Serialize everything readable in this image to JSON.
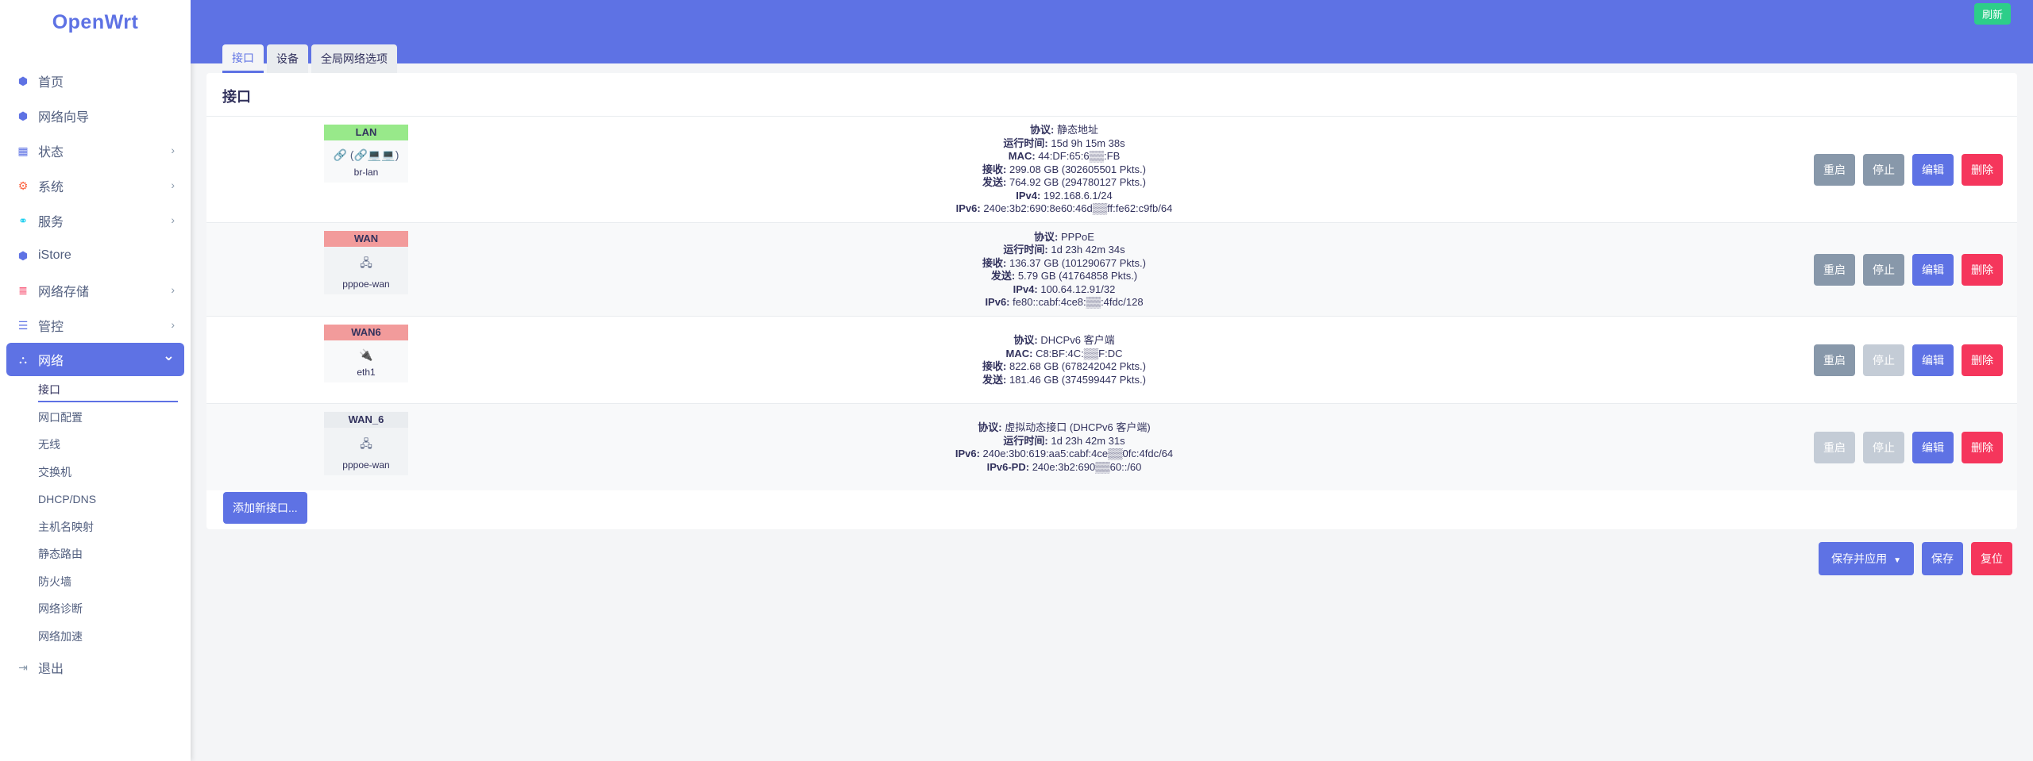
{
  "app": {
    "logo": "OpenWrt",
    "refresh_label": "刷新"
  },
  "sidebar": {
    "items": [
      {
        "label": "首页",
        "icon": "cube-icon",
        "chevron": false
      },
      {
        "label": "网络向导",
        "icon": "cube-icon",
        "chevron": false
      },
      {
        "label": "状态",
        "icon": "grid-icon",
        "chevron": true
      },
      {
        "label": "系统",
        "icon": "gear-icon",
        "chevron": true
      },
      {
        "label": "服务",
        "icon": "link-icon",
        "chevron": true
      },
      {
        "label": "iStore",
        "icon": "cube-icon",
        "chevron": false
      },
      {
        "label": "网络存储",
        "icon": "database-icon",
        "chevron": true
      },
      {
        "label": "管控",
        "icon": "list-icon",
        "chevron": true
      },
      {
        "label": "网络",
        "icon": "sitemap-icon",
        "chevron": true,
        "active": true
      }
    ],
    "subitems": [
      "接口",
      "网口配置",
      "无线",
      "交换机",
      "DHCP/DNS",
      "主机名映射",
      "静态路由",
      "防火墙",
      "网络诊断",
      "网络加速"
    ],
    "logout": "退出"
  },
  "tabs": [
    "接口",
    "设备",
    "全局网络选项"
  ],
  "panel": {
    "title": "接口",
    "add_label": "添加新接口..."
  },
  "interfaces": [
    {
      "name": "LAN",
      "color": "#98e98a",
      "icons": "🔗 (🔗💻💻)",
      "device": "br-lan",
      "lines": [
        [
          "协议:",
          "静态地址"
        ],
        [
          "运行时间:",
          "15d 9h 15m 38s"
        ],
        [
          "MAC:",
          "44:DF:65:6▒▒:FB"
        ],
        [
          "接收:",
          "299.08 GB (302605501 Pkts.)"
        ],
        [
          "发送:",
          "764.92 GB (294780127 Pkts.)"
        ],
        [
          "IPv4:",
          "192.168.6.1/24"
        ],
        [
          "IPv6:",
          "240e:3b2:690:8e60:46d▒▒ff:fe62:c9fb/64"
        ]
      ],
      "restart_disabled": false,
      "stop_disabled": false
    },
    {
      "name": "WAN",
      "color": "#f29b9b",
      "icons": "🖧",
      "device": "pppoe-wan",
      "lines": [
        [
          "协议:",
          "PPPoE"
        ],
        [
          "运行时间:",
          "1d 23h 42m 34s"
        ],
        [
          "接收:",
          "136.37 GB (101290677 Pkts.)"
        ],
        [
          "发送:",
          "5.79 GB (41764858 Pkts.)"
        ],
        [
          "IPv4:",
          "100.64.12.91/32"
        ],
        [
          "IPv6:",
          "fe80::cabf:4ce8:▒▒:4fdc/128"
        ]
      ],
      "restart_disabled": false,
      "stop_disabled": false
    },
    {
      "name": "WAN6",
      "color": "#f29b9b",
      "icons": "🔌",
      "device": "eth1",
      "lines": [
        [
          "协议:",
          "DHCPv6 客户端"
        ],
        [
          "MAC:",
          "C8:BF:4C:▒▒F:DC"
        ],
        [
          "接收:",
          "822.68 GB (678242042 Pkts.)"
        ],
        [
          "发送:",
          "181.46 GB (374599447 Pkts.)"
        ]
      ],
      "restart_disabled": false,
      "stop_disabled": true
    },
    {
      "name": "WAN_6",
      "color": "#e9ecef",
      "icons": "🖧",
      "device": "pppoe-wan",
      "lines": [
        [
          "协议:",
          "虚拟动态接口 (DHCPv6 客户端)"
        ],
        [
          "运行时间:",
          "1d 23h 42m 31s"
        ],
        [
          "IPv6:",
          "240e:3b0:619:aa5:cabf:4ce▒▒0fc:4fdc/64"
        ],
        [
          "IPv6-PD:",
          "240e:3b2:690▒▒60::/60"
        ]
      ],
      "restart_disabled": true,
      "stop_disabled": true
    }
  ],
  "row_actions": {
    "restart": "重启",
    "stop": "停止",
    "edit": "编辑",
    "delete": "删除"
  },
  "footer": {
    "save_apply": "保存并应用",
    "save": "保存",
    "reset": "复位"
  }
}
